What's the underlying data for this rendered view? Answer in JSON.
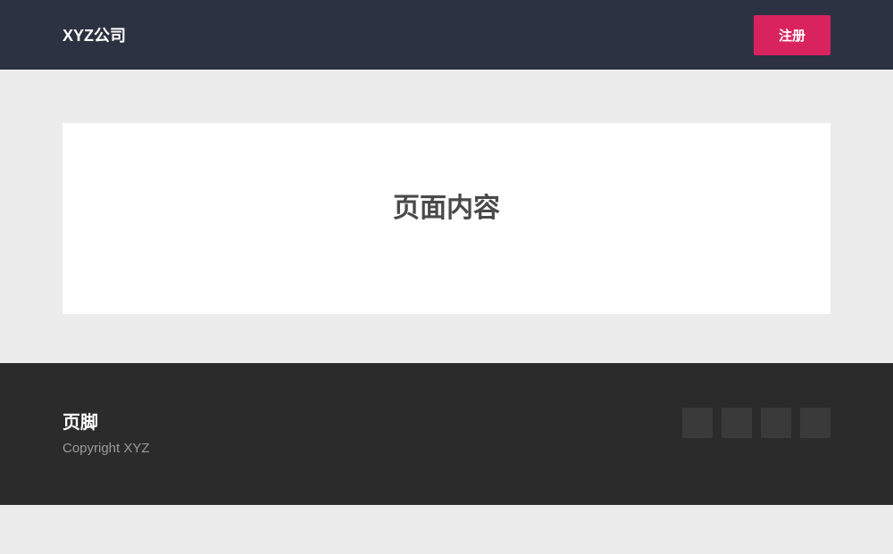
{
  "header": {
    "brand": "XYZ公司",
    "register_label": "注册"
  },
  "main": {
    "content_title": "页面内容"
  },
  "footer": {
    "title": "页脚",
    "copyright": "Copyright XYZ"
  }
}
